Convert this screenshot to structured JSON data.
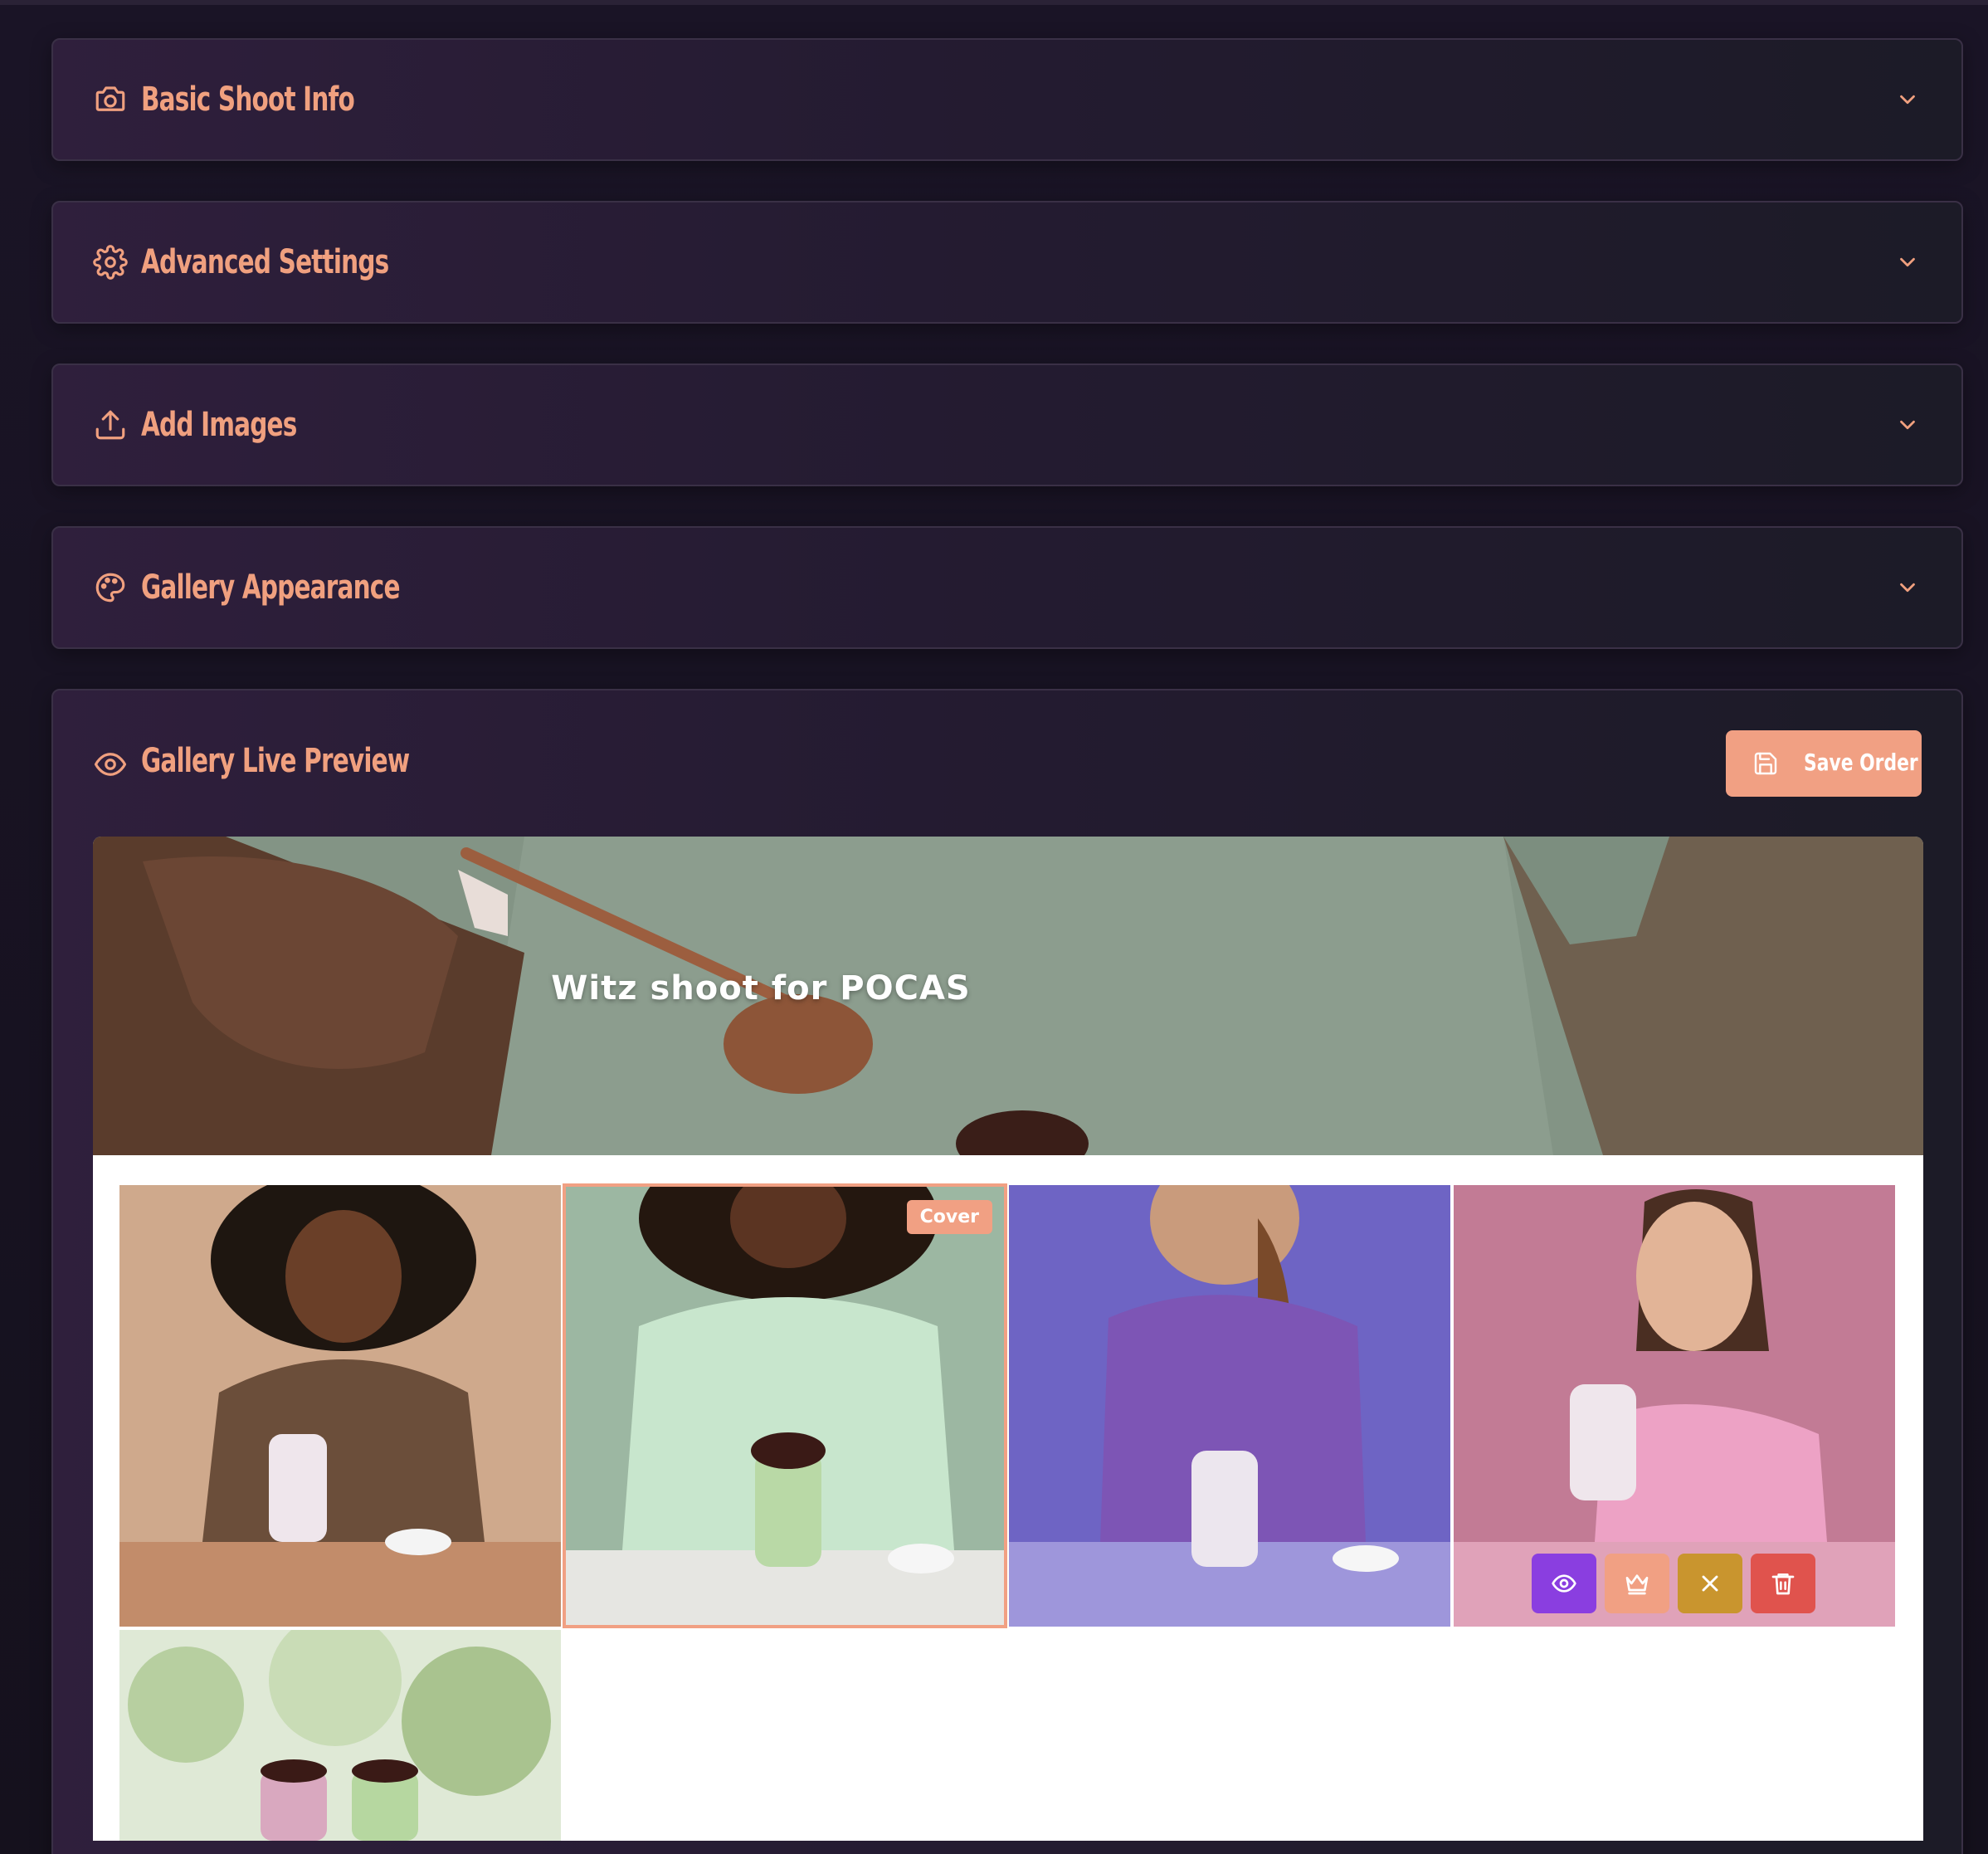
{
  "sections": [
    {
      "title": "Basic Shoot Info",
      "icon": "camera-icon"
    },
    {
      "title": "Advanced Settings",
      "icon": "gear-icon"
    },
    {
      "title": "Add Images",
      "icon": "upload-icon"
    },
    {
      "title": "Gallery Appearance",
      "icon": "palette-icon"
    }
  ],
  "preview": {
    "title": "Gallery Live Preview",
    "icon": "eye-icon",
    "save_label": "Save Order",
    "hero_title": "Witz shoot for POCAS",
    "cover_badge": "Cover",
    "images": [
      {
        "description_icon": "photo-woman-brown-top"
      },
      {
        "description_icon": "photo-woman-green-top",
        "is_cover": true
      },
      {
        "description_icon": "photo-woman-purple-top"
      },
      {
        "description_icon": "photo-woman-pink-top"
      },
      {
        "description_icon": "photo-two-drinks-outdoor"
      }
    ],
    "image_actions": [
      "view-icon",
      "crown-icon",
      "close-icon",
      "trash-icon"
    ]
  },
  "colors": {
    "accent": "#f1a083",
    "action_view": "#8a3ee0",
    "action_cover": "#f1a083",
    "action_hide": "#c9952e",
    "action_delete": "#e0534d"
  }
}
